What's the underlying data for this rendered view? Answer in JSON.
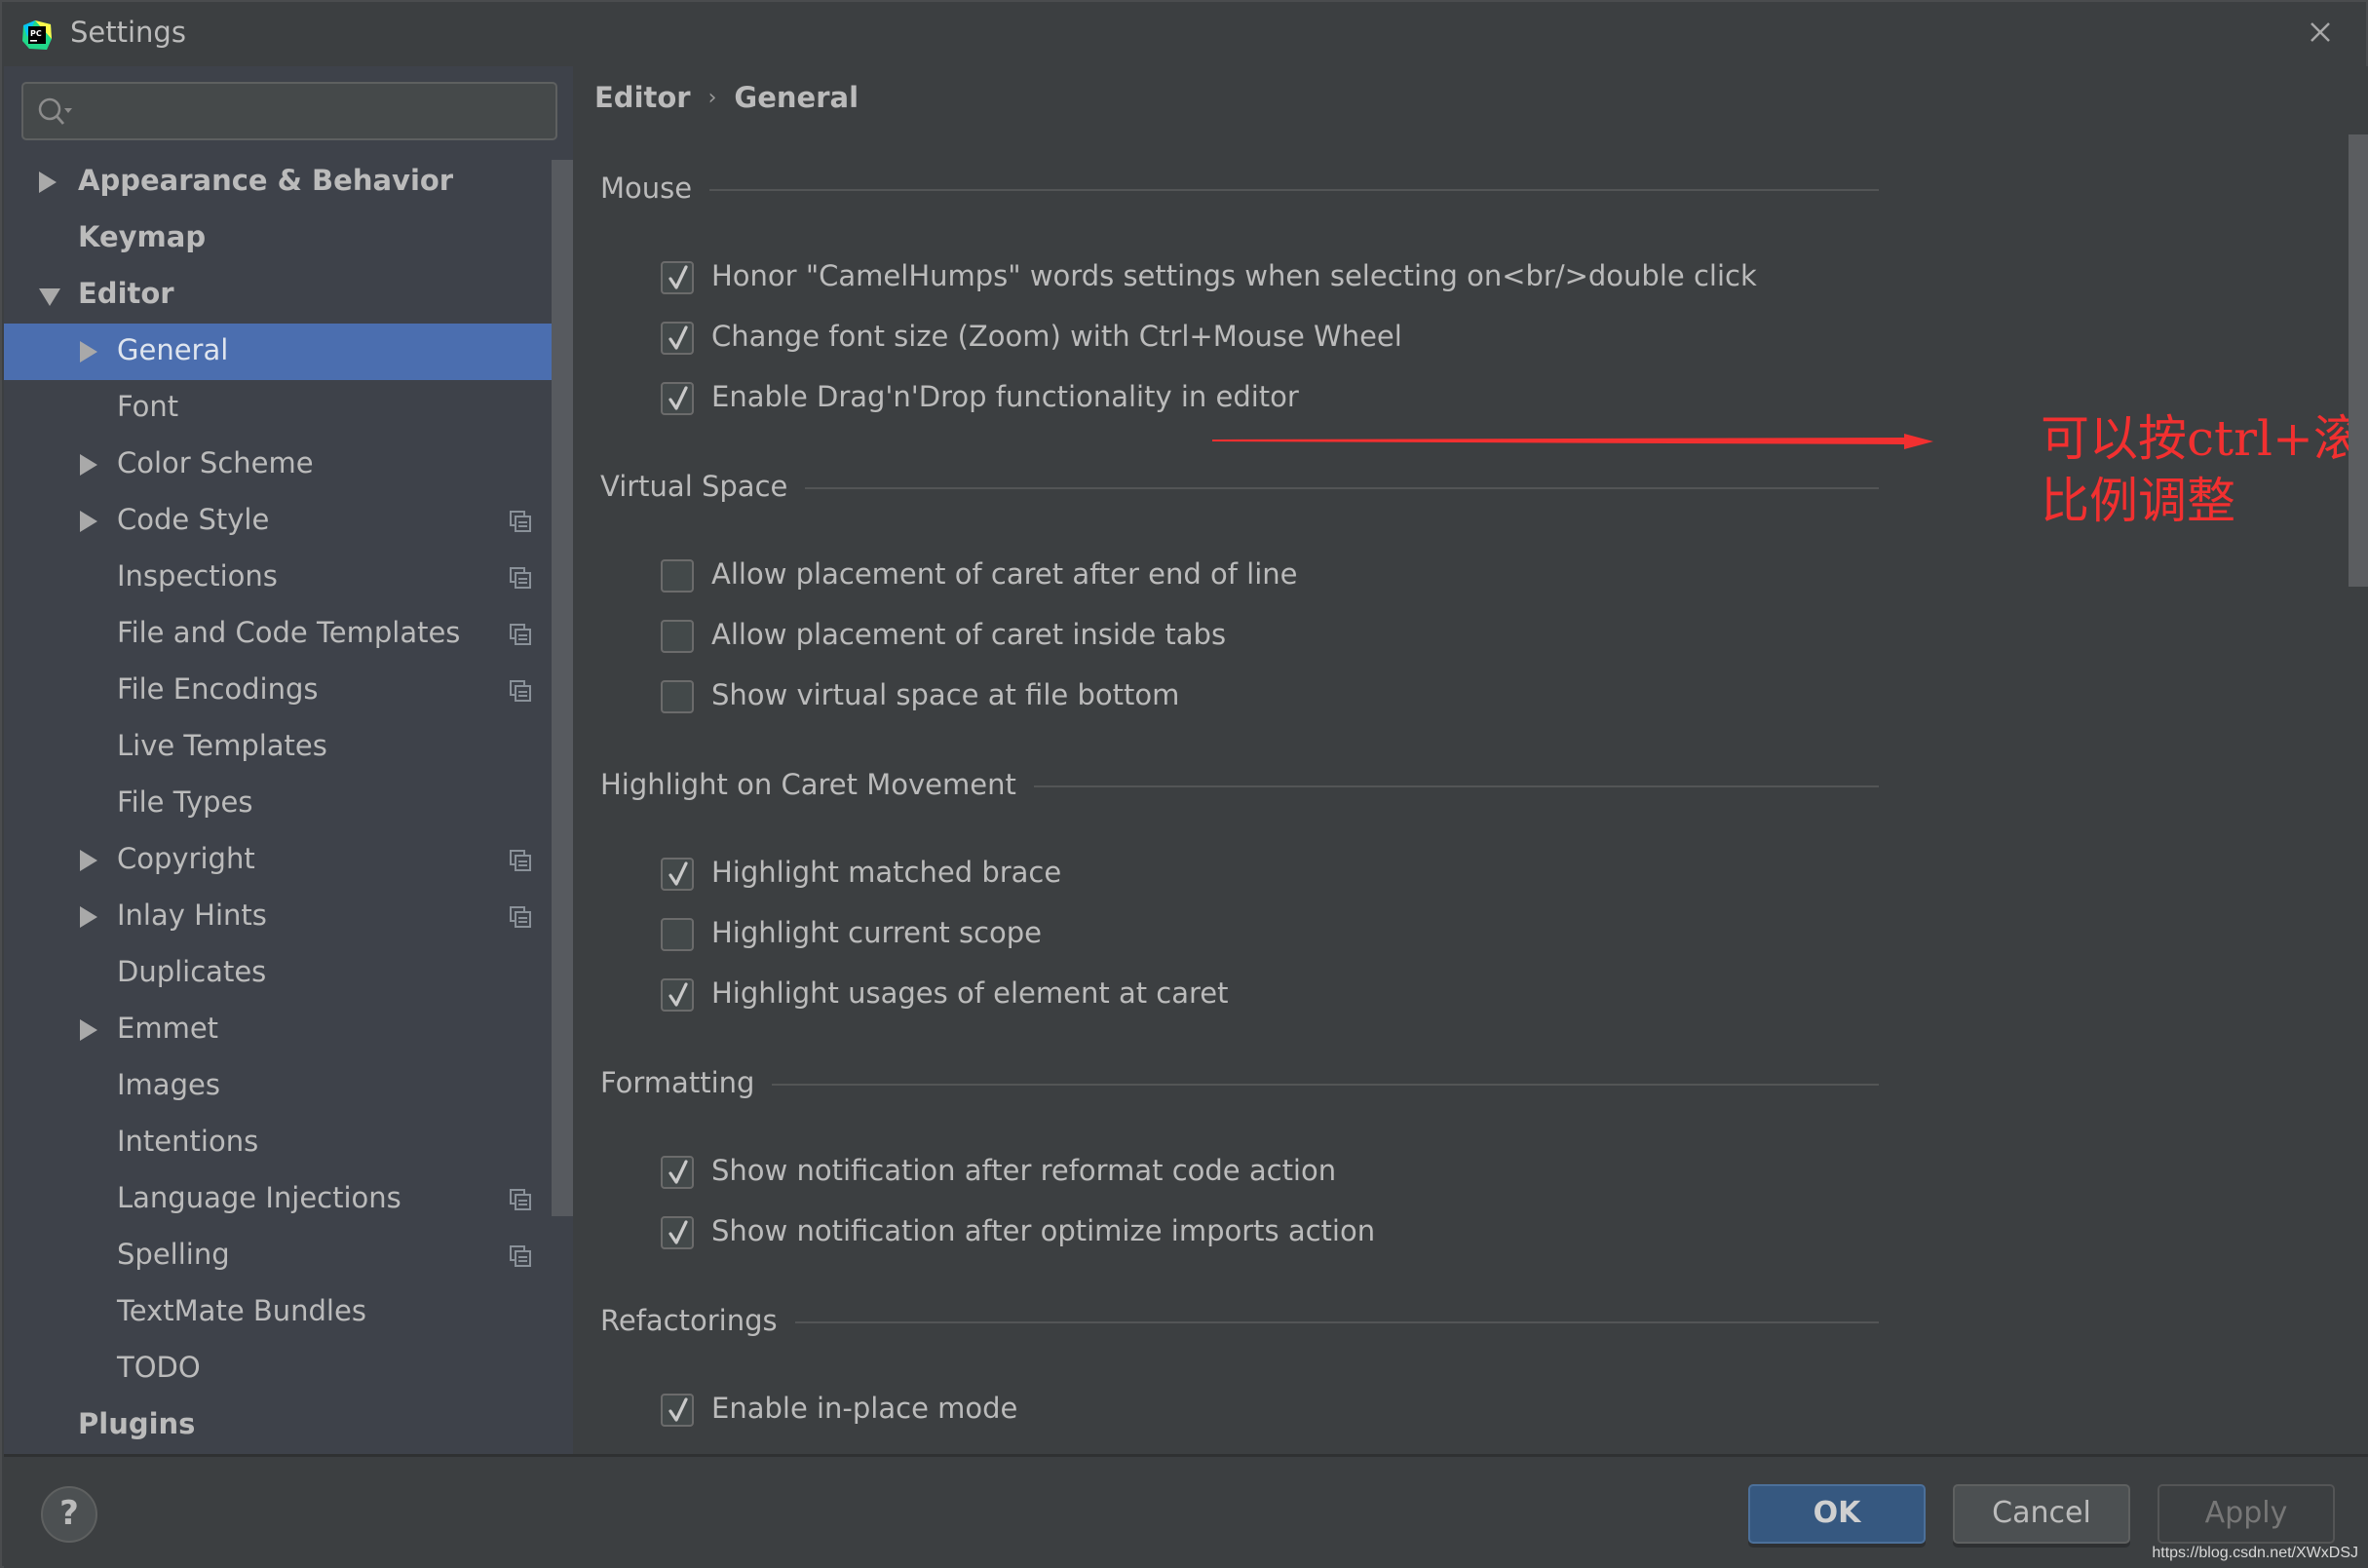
{
  "window": {
    "title": "Settings",
    "app_icon": "pycharm-logo-icon",
    "close_icon": "close-icon"
  },
  "search": {
    "placeholder": "",
    "value": "",
    "icon": "search-icon"
  },
  "sidebar": {
    "items": [
      {
        "label": "Appearance & Behavior",
        "level": 0,
        "arrow": "right",
        "project_icon": false,
        "selected": false
      },
      {
        "label": "Keymap",
        "level": 0,
        "arrow": "none",
        "project_icon": false,
        "selected": false
      },
      {
        "label": "Editor",
        "level": 0,
        "arrow": "down",
        "project_icon": false,
        "selected": false
      },
      {
        "label": "General",
        "level": 1,
        "arrow": "right",
        "project_icon": false,
        "selected": true
      },
      {
        "label": "Font",
        "level": 1,
        "arrow": "none",
        "project_icon": false,
        "selected": false
      },
      {
        "label": "Color Scheme",
        "level": 1,
        "arrow": "right",
        "project_icon": false,
        "selected": false
      },
      {
        "label": "Code Style",
        "level": 1,
        "arrow": "right",
        "project_icon": true,
        "selected": false
      },
      {
        "label": "Inspections",
        "level": 1,
        "arrow": "none",
        "project_icon": true,
        "selected": false
      },
      {
        "label": "File and Code Templates",
        "level": 1,
        "arrow": "none",
        "project_icon": true,
        "selected": false
      },
      {
        "label": "File Encodings",
        "level": 1,
        "arrow": "none",
        "project_icon": true,
        "selected": false
      },
      {
        "label": "Live Templates",
        "level": 1,
        "arrow": "none",
        "project_icon": false,
        "selected": false
      },
      {
        "label": "File Types",
        "level": 1,
        "arrow": "none",
        "project_icon": false,
        "selected": false
      },
      {
        "label": "Copyright",
        "level": 1,
        "arrow": "right",
        "project_icon": true,
        "selected": false
      },
      {
        "label": "Inlay Hints",
        "level": 1,
        "arrow": "right",
        "project_icon": true,
        "selected": false
      },
      {
        "label": "Duplicates",
        "level": 1,
        "arrow": "none",
        "project_icon": false,
        "selected": false
      },
      {
        "label": "Emmet",
        "level": 1,
        "arrow": "right",
        "project_icon": false,
        "selected": false
      },
      {
        "label": "Images",
        "level": 1,
        "arrow": "none",
        "project_icon": false,
        "selected": false
      },
      {
        "label": "Intentions",
        "level": 1,
        "arrow": "none",
        "project_icon": false,
        "selected": false
      },
      {
        "label": "Language Injections",
        "level": 1,
        "arrow": "none",
        "project_icon": true,
        "selected": false
      },
      {
        "label": "Spelling",
        "level": 1,
        "arrow": "none",
        "project_icon": true,
        "selected": false
      },
      {
        "label": "TextMate Bundles",
        "level": 1,
        "arrow": "none",
        "project_icon": false,
        "selected": false
      },
      {
        "label": "TODO",
        "level": 1,
        "arrow": "none",
        "project_icon": false,
        "selected": false
      },
      {
        "label": "Plugins",
        "level": 0,
        "arrow": "none",
        "project_icon": false,
        "selected": false
      }
    ]
  },
  "breadcrumb": {
    "items": [
      "Editor",
      "General"
    ],
    "separator": "›"
  },
  "sections": [
    {
      "title": "Mouse",
      "options": [
        {
          "label": "Honor \"CamelHumps\" words settings when selecting on<br/>double click",
          "checked": true
        },
        {
          "label": "Change font size (Zoom) with Ctrl+Mouse Wheel",
          "checked": true
        },
        {
          "label": "Enable Drag'n'Drop functionality in editor",
          "checked": true
        }
      ]
    },
    {
      "title": "Virtual Space",
      "options": [
        {
          "label": "Allow placement of caret after end of line",
          "checked": false
        },
        {
          "label": "Allow placement of caret inside tabs",
          "checked": false
        },
        {
          "label": "Show virtual space at file bottom",
          "checked": false
        }
      ]
    },
    {
      "title": "Highlight on Caret Movement",
      "options": [
        {
          "label": "Highlight matched brace",
          "checked": true
        },
        {
          "label": "Highlight current scope",
          "checked": false
        },
        {
          "label": "Highlight usages of element at caret",
          "checked": true
        }
      ]
    },
    {
      "title": "Formatting",
      "options": [
        {
          "label": "Show notification after reformat code action",
          "checked": true
        },
        {
          "label": "Show notification after optimize imports action",
          "checked": true
        }
      ]
    },
    {
      "title": "Refactorings",
      "options": [
        {
          "label": "Enable in-place mode",
          "checked": true
        }
      ]
    }
  ],
  "annotation": {
    "text": "可以按ctrl+滚轮来进行编辑页面的显示比例调整",
    "color": "#f23030"
  },
  "footer": {
    "help_label": "?",
    "ok_label": "OK",
    "cancel_label": "Cancel",
    "apply_label": "Apply",
    "watermark": "https://blog.csdn.net/XWxDSJ"
  },
  "colors": {
    "selection": "#4b6eaf",
    "background": "#3c3f41",
    "sidebar": "#3e424a",
    "ok_button": "#365880"
  }
}
